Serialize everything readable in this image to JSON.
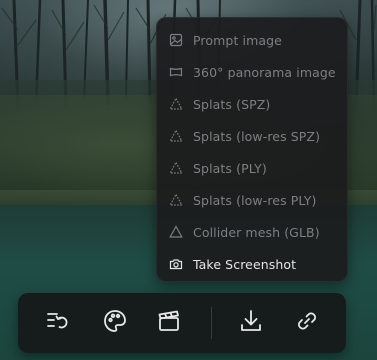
{
  "menu": {
    "items": [
      {
        "label": "Prompt image",
        "icon": "image-icon",
        "enabled": false
      },
      {
        "label": "360° panorama image",
        "icon": "panorama-icon",
        "enabled": false
      },
      {
        "label": "Splats (SPZ)",
        "icon": "splat-icon",
        "enabled": false
      },
      {
        "label": "Splats (low-res SPZ)",
        "icon": "splat-icon",
        "enabled": false
      },
      {
        "label": "Splats (PLY)",
        "icon": "splat-icon",
        "enabled": false
      },
      {
        "label": "Splats (low-res PLY)",
        "icon": "splat-icon",
        "enabled": false
      },
      {
        "label": "Collider mesh (GLB)",
        "icon": "mesh-icon",
        "enabled": false
      },
      {
        "label": "Take Screenshot",
        "icon": "camera-icon",
        "enabled": true
      }
    ]
  },
  "toolbar": {
    "buttons": [
      {
        "name": "history-icon"
      },
      {
        "name": "palette-icon"
      },
      {
        "name": "clapperboard-icon"
      },
      {
        "name": "download-icon"
      },
      {
        "name": "link-icon"
      }
    ]
  },
  "colors": {
    "menu_bg": "#1c1d1e",
    "text_disabled": "#7d7f82",
    "text_enabled": "#e6e6e6",
    "toolbar_icon": "#e8e8e8"
  }
}
